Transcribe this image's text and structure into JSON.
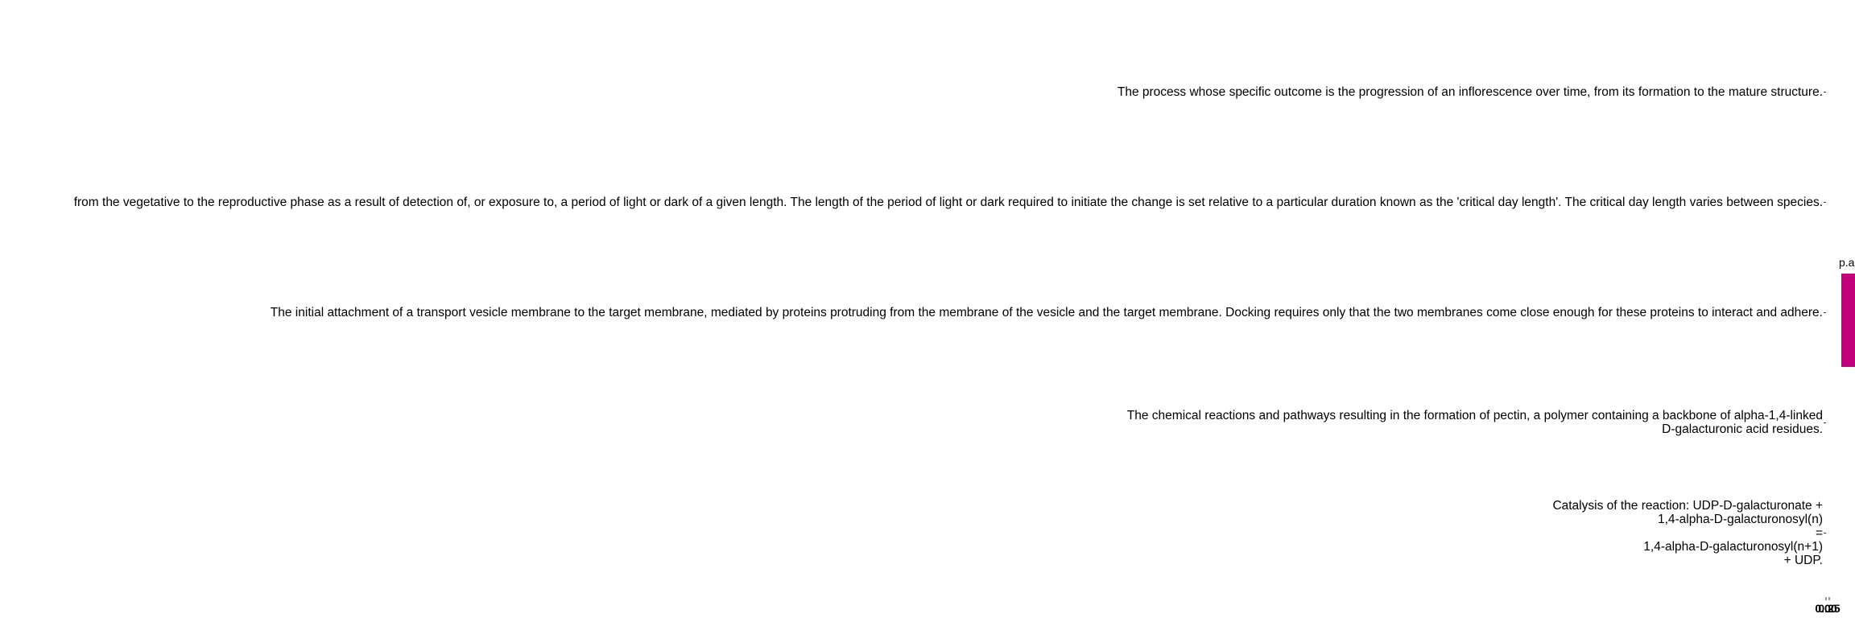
{
  "chart_data": {
    "type": "bar",
    "categories": [
      "The process whose specific outcome is the progression of an inflorescence over time, from its formation to the mature structure.",
      "from the vegetative to the reproductive phase as a result of detection of, or exposure to, a period of light or dark of a given length. The length of the period of light or dark required to initiate the change is set relative to a particular duration known as the 'critical day length'. The critical day length varies between species.",
      "The initial attachment of a transport vesicle membrane to the target membrane, mediated by proteins protruding from the membrane of the vesicle and the target membrane. Docking requires only that the two membranes come close enough for these proteins to interact and adhere.",
      "The chemical reactions and pathways resulting in the formation of pectin, a polymer containing a backbone of alpha-1,4-linked D-galacturonic acid residues.",
      "Catalysis of the reaction: UDP-D-galacturonate + 1,4-alpha-D-galacturonosyl(n) = 1,4-alpha-D-galacturonosyl(n+1) + UDP."
    ],
    "category_lines": [
      [
        "The process whose specific outcome is the progression of an inflorescence over time, from its formation to the mature structure."
      ],
      [
        "from the vegetative to the reproductive phase as a result of detection of, or exposure to, a period of light or dark of a given length. The length of the period of light or dark required to initiate the change is set relative to a particular duration known as the 'critical day length'. The critical day length varies between species."
      ],
      [
        "The initial attachment of a transport vesicle membrane to the target membrane, mediated by proteins protruding from the membrane of the vesicle and the target membrane. Docking requires only that the two membranes come close enough for these proteins to interact and adhere."
      ],
      [
        "The chemical reactions and pathways resulting in the formation of pectin, a polymer containing a backbone of alpha-1,4-linked",
        "D-galacturonic acid residues."
      ],
      [
        "Catalysis of the reaction: UDP-D-galacturonate +",
        "1,4-alpha-D-galacturonosyl(n)",
        "=",
        "1,4-alpha-D-galacturonosyl(n+1)",
        "+ UDP."
      ]
    ],
    "values": [
      0,
      0,
      0,
      0,
      0
    ],
    "xtick_labels": [
      "0.00",
      "0.25"
    ],
    "legend": {
      "title": "p.adj",
      "position": "right",
      "color": "#c1007a"
    },
    "orientation": "horizontal",
    "grid": false
  }
}
